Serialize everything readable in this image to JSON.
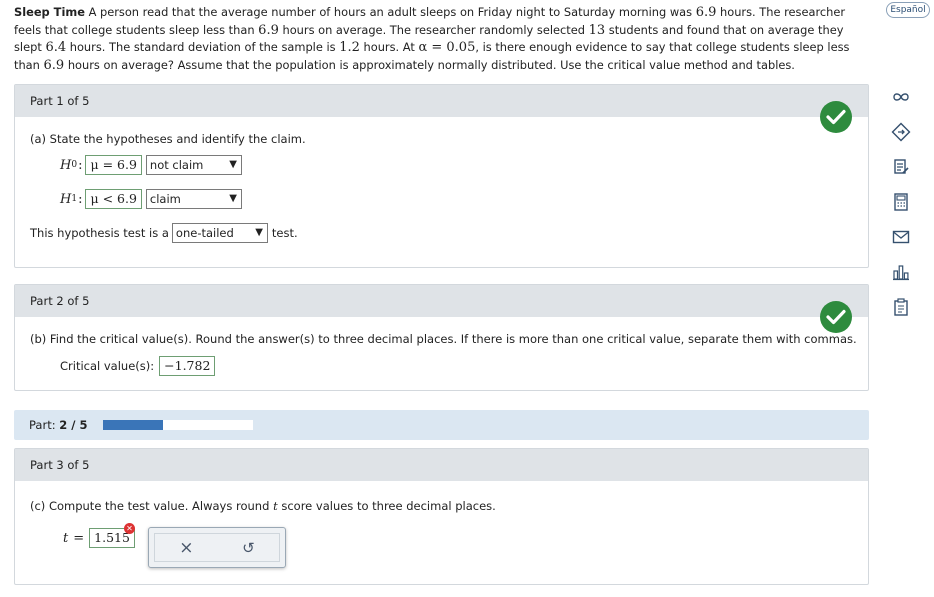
{
  "language_button": "Español",
  "problem": {
    "title": "Sleep Time",
    "s1": " A person read that the average number of hours an adult sleeps on Friday night to Saturday morning was ",
    "n1": "6.9",
    "s2": " hours. The researcher feels that college students sleep less than ",
    "n2": "6.9",
    "s3": " hours on average. The researcher randomly selected ",
    "n3": "13",
    "s4": " students and found that on average they slept ",
    "n4": "6.4",
    "s5": " hours. The standard deviation of the sample is ",
    "n5": "1.2",
    "s6": " hours. At ",
    "n6": "α = 0.05",
    "s7": ", is there enough evidence to say that college students sleep less than ",
    "n7": "6.9",
    "s8": " hours on average? Assume that the population is approximately normally distributed. Use the critical value method and tables."
  },
  "part1": {
    "header": "Part 1 of 5",
    "question": "(a) State the hypotheses and identify the claim.",
    "h0_symbol": "H",
    "h0_sub": "0",
    "h0_value": "μ = 6.9",
    "h0_claim": "not claim",
    "h1_symbol": "H",
    "h1_sub": "1",
    "h1_value": "μ < 6.9",
    "h1_claim": "claim",
    "colon": ":",
    "test_prefix": "This hypothesis test is a",
    "test_type": "one-tailed",
    "test_suffix": "test."
  },
  "part2": {
    "header": "Part 2 of 5",
    "question": "(b) Find the critical value(s). Round the answer(s) to three decimal places. If there is more than one critical value, separate them with commas.",
    "cv_label": "Critical value(s):",
    "cv_value": "−1.782"
  },
  "progress": {
    "label_prefix": "Part:",
    "current": "2",
    "separator": " / ",
    "total": "5",
    "fraction": 0.4
  },
  "part3": {
    "header": "Part 3 of 5",
    "q_before": "(c) Compute the test value. Always round ",
    "q_var": "t",
    "q_after": " score values to three decimal places.",
    "t_label": "t",
    "equals": "=",
    "t_value": "1.515",
    "error_mark": "✕",
    "clear_glyph": "×",
    "undo_glyph": "↺"
  },
  "side_tools": [
    "infinity-icon",
    "tag-icon",
    "notes-icon",
    "calculator-icon",
    "mail-icon",
    "chart-icon",
    "clipboard-icon"
  ],
  "colors": {
    "accent": "#3a75b8",
    "correct": "#2e8b3e",
    "error": "#d33333"
  }
}
